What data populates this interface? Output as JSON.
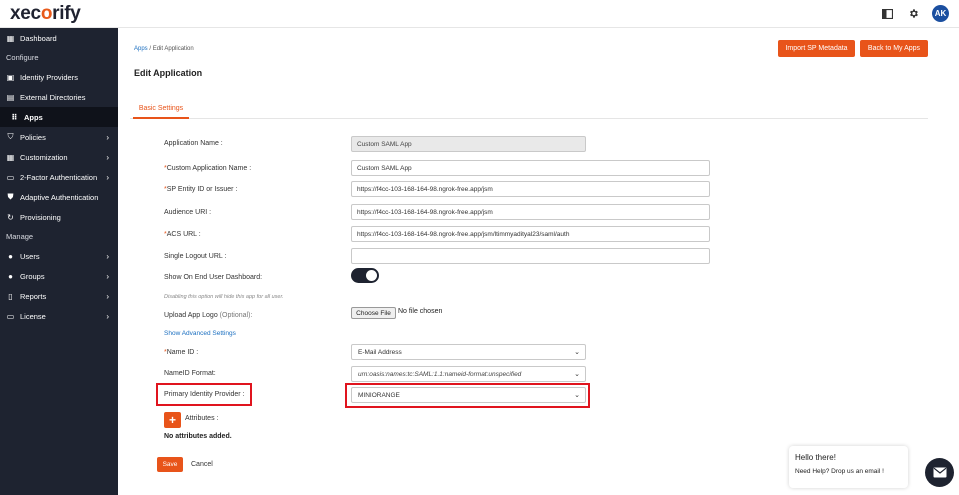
{
  "app": {
    "logo_pre": "xec",
    "logo_mid": "o",
    "logo_post": "rify"
  },
  "topbar": {
    "avatar": "AK"
  },
  "sidebar": {
    "items": [
      {
        "label": "Dashboard",
        "icon": "dashboard-icon",
        "glyph": "▦"
      },
      {
        "section": "Configure"
      },
      {
        "label": "Identity Providers",
        "icon": "briefcase-icon",
        "glyph": "▣"
      },
      {
        "label": "External Directories",
        "icon": "directory-icon",
        "glyph": "▤"
      },
      {
        "label": "Apps",
        "icon": "grid-icon",
        "glyph": "⠿",
        "active": true
      },
      {
        "label": "Policies",
        "icon": "shield-icon",
        "glyph": "⛉",
        "chevron": true
      },
      {
        "label": "Customization",
        "icon": "customization-icon",
        "glyph": "▦",
        "chevron": true
      },
      {
        "label": "2-Factor Authentication",
        "icon": "keypad-icon",
        "glyph": "▭",
        "chevron": true
      },
      {
        "label": "Adaptive Authentication",
        "icon": "shield-check-icon",
        "glyph": "⛊"
      },
      {
        "label": "Provisioning",
        "icon": "sync-icon",
        "glyph": "↻"
      },
      {
        "section": "Manage"
      },
      {
        "label": "Users",
        "icon": "user-icon",
        "glyph": "●",
        "chevron": true
      },
      {
        "label": "Groups",
        "icon": "group-icon",
        "glyph": "●",
        "chevron": true
      },
      {
        "label": "Reports",
        "icon": "reports-icon",
        "glyph": "▯",
        "chevron": true
      },
      {
        "label": "License",
        "icon": "license-icon",
        "glyph": "▭",
        "chevron": true
      }
    ]
  },
  "breadcrumb": {
    "root": "Apps",
    "sep": "/",
    "current": "Edit Application"
  },
  "header": {
    "title": "Edit Application",
    "import_button": "Import SP Metadata",
    "back_button": "Back to My Apps"
  },
  "tabs": {
    "basic": "Basic Settings"
  },
  "form": {
    "app_name_label": "Application Name :",
    "app_name_value": "Custom SAML App",
    "custom_name_label": "Custom Application Name :",
    "custom_name_value": "Custom SAML App",
    "entity_label": "SP Entity ID or Issuer :",
    "entity_value": "https://f4cc-103-168-164-98.ngrok-free.app/jsm",
    "audience_label": "Audience URI :",
    "audience_value": "https://f4cc-103-168-164-98.ngrok-free.app/jsm",
    "acs_label": "ACS URL :",
    "acs_value": "https://f4cc-103-168-164-98.ngrok-free.app/jsm/ltimmyadityal23/saml/auth",
    "slo_label": "Single Logout URL :",
    "slo_value": "",
    "dashboard_label": "Show On End User Dashboard:",
    "dashboard_on": true,
    "dashboard_hint": "Disabling this option will hide this app for all user.",
    "logo_label": "Upload App Logo",
    "logo_optional": "(Optional):",
    "choose_file": "Choose File",
    "no_file": "No file chosen",
    "advanced_link": "Show Advanced Settings",
    "name_id_label": "Name ID :",
    "name_id_value": "E-Mail Address",
    "nameid_format_label": "NameID Format:",
    "nameid_format_value": "urn:oasis:names:tc:SAML:1.1:nameid-format:unspecified",
    "primary_idp_label": "Primary Identity Provider :",
    "primary_idp_value": "MINIORANGE",
    "attributes_label": "Attributes :",
    "no_attributes": "No attributes added.",
    "save": "Save",
    "cancel": "Cancel"
  },
  "chat": {
    "title": "Hello there!",
    "message": "Need Help? Drop us an email !"
  },
  "colors": {
    "accent": "#e8541a",
    "sidebar": "#1e2330",
    "highlight": "#e0141e",
    "link": "#1b6fc0"
  }
}
